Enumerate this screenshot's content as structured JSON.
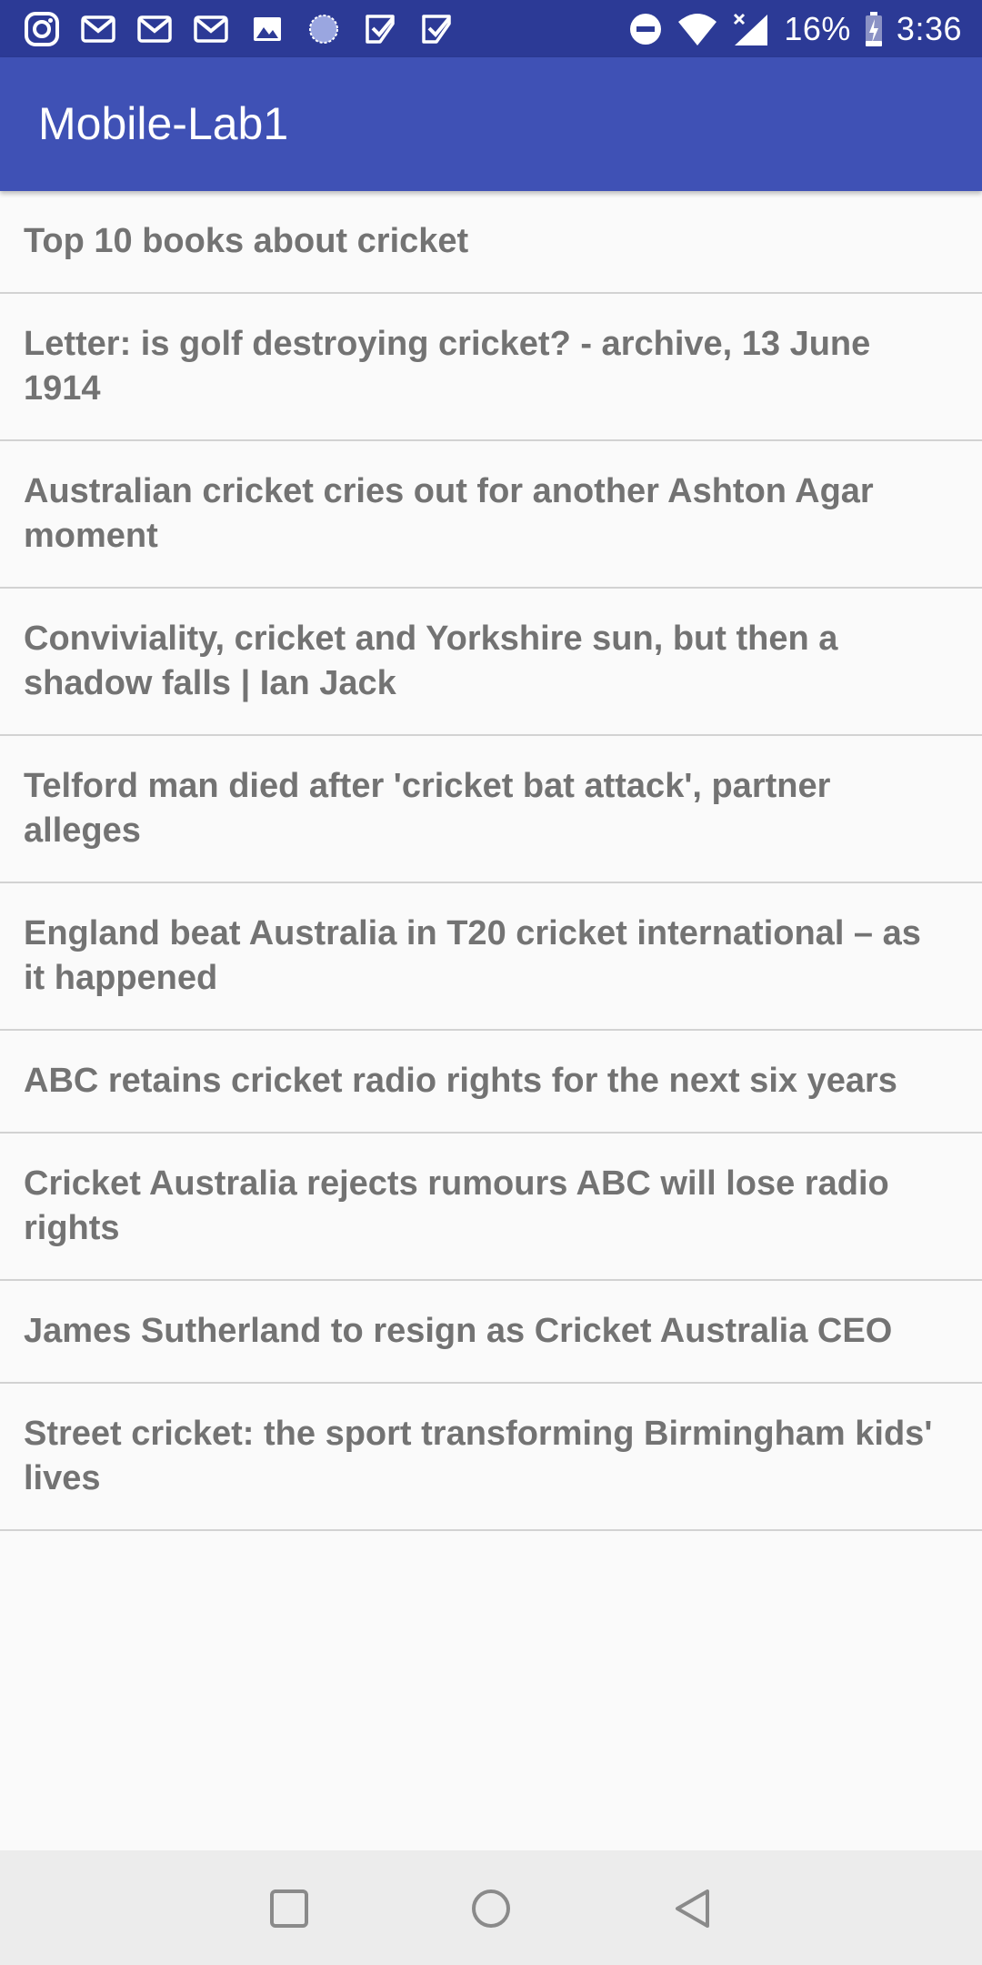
{
  "status_bar": {
    "background": "#2c3a96",
    "left_icons": [
      "instagram-icon",
      "gmail-icon",
      "gmail-icon",
      "gmail-icon",
      "image-icon",
      "loading-circle-icon",
      "checkbox-icon",
      "checkbox-icon"
    ],
    "right_icons": [
      "do-not-disturb-icon",
      "wifi-icon",
      "cell-signal-icon",
      "battery-charging-icon"
    ],
    "battery_text": "16%",
    "time": "3:36"
  },
  "app_bar": {
    "title": "Mobile-Lab1",
    "color": "#3f51b5"
  },
  "articles": [
    {
      "title": "Top 10 books about cricket"
    },
    {
      "title": "Letter: is golf destroying cricket? - archive, 13 June 1914"
    },
    {
      "title": "Australian cricket cries out for another Ashton Agar moment"
    },
    {
      "title": "Conviviality, cricket and Yorkshire sun, but then a shadow falls | Ian Jack"
    },
    {
      "title": "Telford man died after 'cricket bat attack', partner alleges"
    },
    {
      "title": "England beat Australia in T20 cricket international – as it happened"
    },
    {
      "title": "ABC retains cricket radio rights for the next six years"
    },
    {
      "title": "Cricket Australia rejects rumours ABC will lose radio rights"
    },
    {
      "title": "James Sutherland to resign as Cricket Australia CEO"
    },
    {
      "title": "Street cricket: the sport transforming Birmingham kids' lives"
    }
  ],
  "nav_bar": {
    "buttons": [
      "recents-square-icon",
      "home-circle-icon",
      "back-triangle-icon"
    ]
  }
}
